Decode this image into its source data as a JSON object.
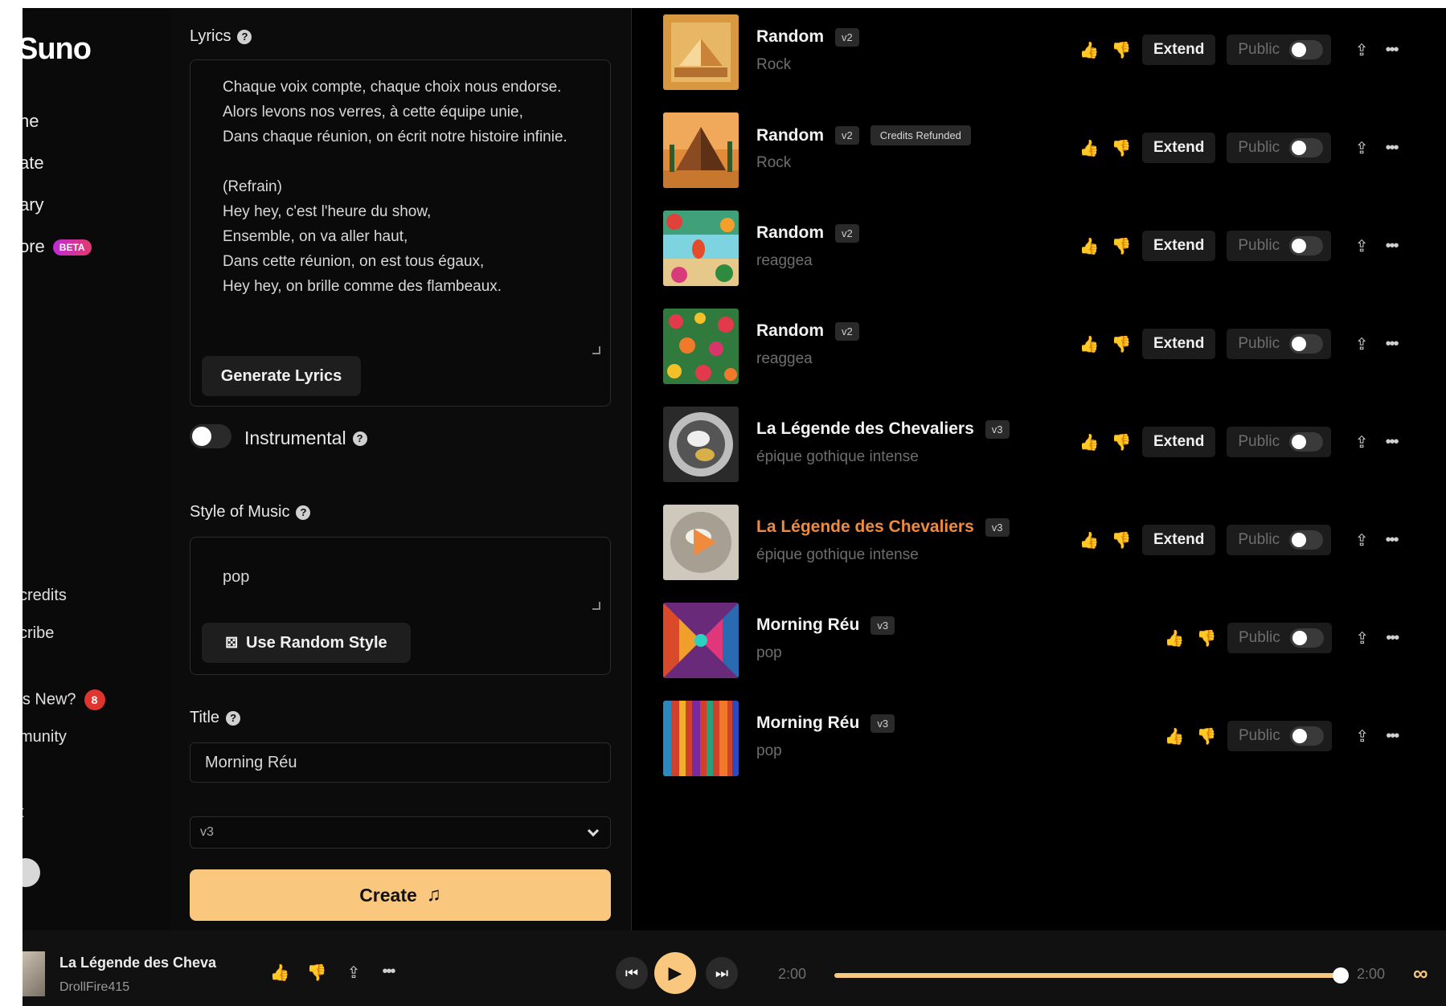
{
  "sidebar": {
    "logo": "Suno",
    "nav": [
      "ne",
      "ate",
      "ary",
      "ore"
    ],
    "beta_label": "BETA",
    "credits": "credits",
    "subscribe": "cribe",
    "whats_new": "'s New?",
    "whats_new_count": "8",
    "community": "munity",
    "extra": "t"
  },
  "create": {
    "lyrics_label": "Lyrics",
    "lyrics_text": "Chaque voix compte, chaque choix nous endorse.\nAlors levons nos verres, à cette équipe unie,\nDans chaque réunion, on écrit notre histoire infinie.\n\n(Refrain)\nHey hey, c'est l'heure du show,\nEnsemble, on va aller haut,\nDans cette réunion, on est tous égaux,\nHey hey, on brille comme des flambeaux.",
    "generate_lyrics": "Generate Lyrics",
    "instrumental_label": "Instrumental",
    "style_label": "Style of Music",
    "style_value": "pop",
    "random_style": "Use Random Style",
    "title_label": "Title",
    "title_value": "Morning Réu",
    "model_value": "v3",
    "create_button": "Create"
  },
  "songs": [
    {
      "title": "Random",
      "version": "v2",
      "style": "Rock",
      "extend": "Extend",
      "public": "Public",
      "tag": ""
    },
    {
      "title": "Random",
      "version": "v2",
      "style": "Rock",
      "extend": "Extend",
      "public": "Public",
      "tag": "Credits Refunded"
    },
    {
      "title": "Random",
      "version": "v2",
      "style": "reaggea",
      "extend": "Extend",
      "public": "Public",
      "tag": ""
    },
    {
      "title": "Random",
      "version": "v2",
      "style": "reaggea",
      "extend": "Extend",
      "public": "Public",
      "tag": ""
    },
    {
      "title": "La Légende des Chevaliers",
      "version": "v3",
      "style": "épique gothique intense",
      "extend": "Extend",
      "public": "Public",
      "tag": ""
    },
    {
      "title": "La Légende des Chevaliers",
      "version": "v3",
      "style": "épique gothique intense",
      "extend": "Extend",
      "public": "Public",
      "tag": ""
    },
    {
      "title": "Morning Réu",
      "version": "v3",
      "style": "pop",
      "extend": "",
      "public": "Public",
      "tag": ""
    },
    {
      "title": "Morning Réu",
      "version": "v3",
      "style": "pop",
      "extend": "",
      "public": "Public",
      "tag": ""
    }
  ],
  "player": {
    "title": "La Légende des Cheva",
    "artist": "DrollFire415",
    "current_time": "2:00",
    "total_time": "2:00",
    "progress": 1.0
  },
  "colors": {
    "accent": "#f9c77e",
    "active_title": "#f08a3c",
    "badge": "#e0342e"
  }
}
